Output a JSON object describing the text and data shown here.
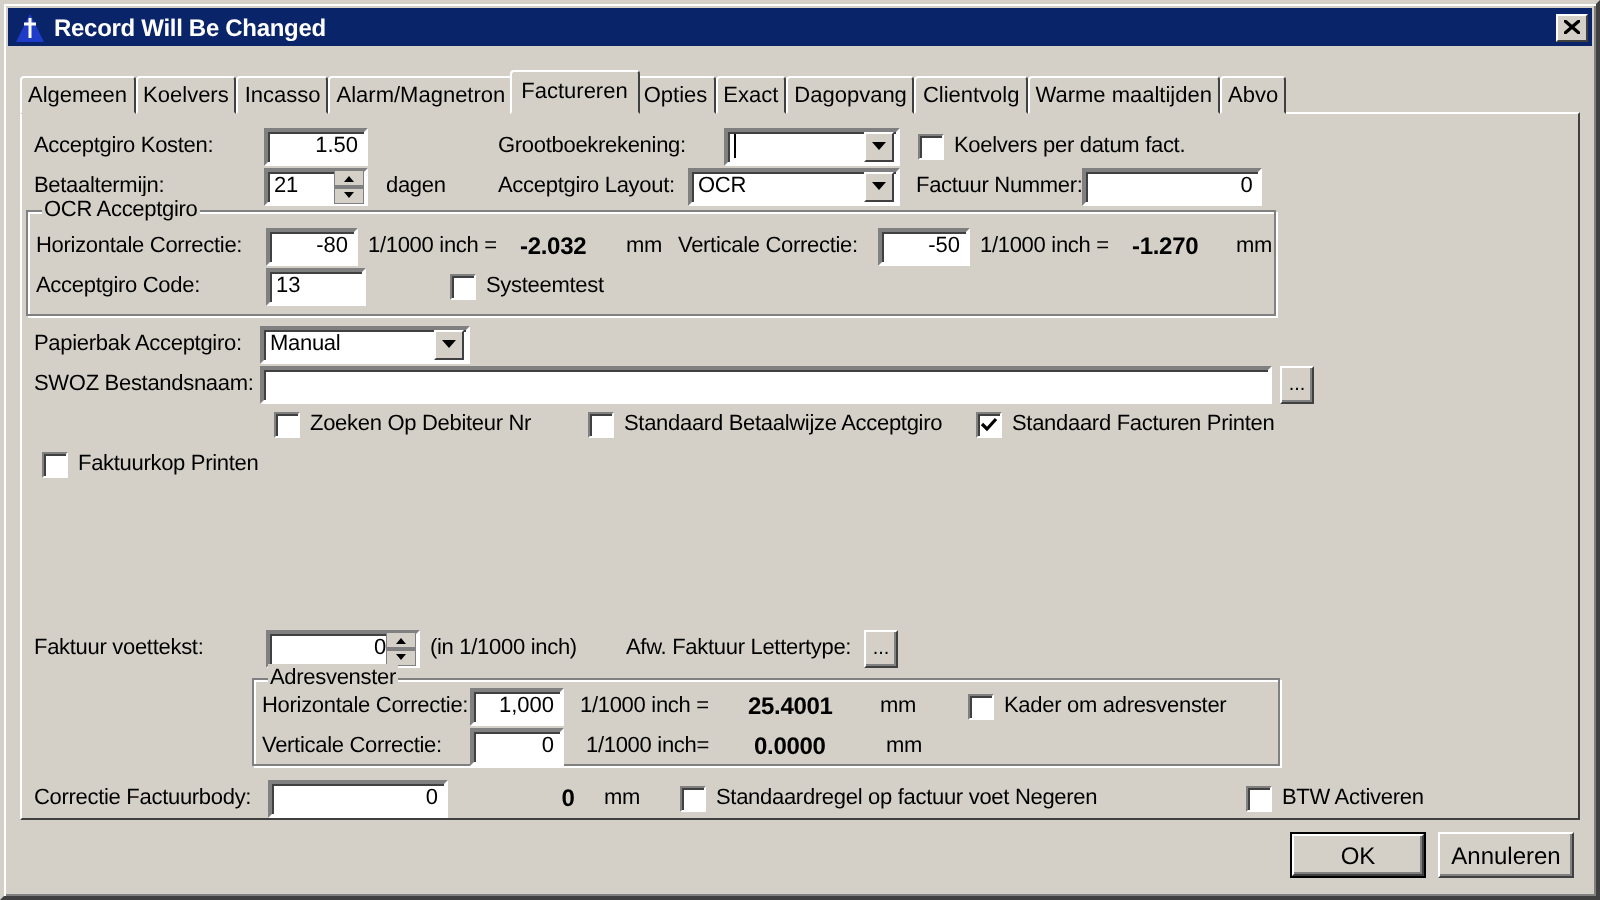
{
  "window": {
    "title": "Record Will Be Changed"
  },
  "tabs": [
    {
      "label": "Algemeen",
      "selected": false
    },
    {
      "label": "Koelvers",
      "selected": false
    },
    {
      "label": "Incasso",
      "selected": false
    },
    {
      "label": "Alarm/Magnetron",
      "selected": false
    },
    {
      "label": "Factureren",
      "selected": true
    },
    {
      "label": "Opties",
      "selected": false
    },
    {
      "label": "Exact",
      "selected": false
    },
    {
      "label": "Dagopvang",
      "selected": false
    },
    {
      "label": "Clientvolg",
      "selected": false
    },
    {
      "label": "Warme maaltijden",
      "selected": false
    },
    {
      "label": "Abvo",
      "selected": false
    }
  ],
  "acceptgiro_kosten": {
    "label": "Acceptgiro Kosten:",
    "value": "1.50"
  },
  "grootboekrekening": {
    "label": "Grootboekrekening:"
  },
  "koelvers_per_datum": {
    "label": "Koelvers per datum fact.",
    "checked": false
  },
  "betaaltermijn": {
    "label": "Betaaltermijn:",
    "value": "21",
    "unit": "dagen"
  },
  "acceptgiro_layout": {
    "label": "Acceptgiro Layout:",
    "value": "OCR"
  },
  "factuur_nummer": {
    "label": "Factuur Nummer:",
    "value": "0"
  },
  "ocr_group": {
    "title": "OCR Acceptgiro",
    "horizontal": {
      "label": "Horizontale Correctie:",
      "value": "-80",
      "unit": "1/1000 inch =",
      "result": "-2.032",
      "result_unit": "mm"
    },
    "vertical": {
      "label": "Verticale Correctie:",
      "value": "-50",
      "unit": "1/1000 inch =",
      "result": "-1.270",
      "result_unit": "mm"
    },
    "code": {
      "label": "Acceptgiro Code:",
      "value": "13"
    },
    "systeemtest": {
      "label": "Systeemtest",
      "checked": false
    }
  },
  "papierbak": {
    "label": "Papierbak Acceptgiro:",
    "value": "Manual"
  },
  "swoz": {
    "label": "SWOZ Bestandsnaam:",
    "browse": "..."
  },
  "options": [
    {
      "label": "Zoeken Op Debiteur Nr",
      "checked": false
    },
    {
      "label": "Standaard Betaalwijze Acceptgiro",
      "checked": false
    },
    {
      "label": "Standaard Facturen Printen",
      "checked": true
    }
  ],
  "faktuurkop": {
    "label": "Faktuurkop Printen",
    "checked": false
  },
  "voettekst": {
    "label": "Faktuur voettekst:",
    "value": "0",
    "unit": "(in 1/1000 inch)"
  },
  "lettertype": {
    "label": "Afw. Faktuur Lettertype:",
    "button": "..."
  },
  "adres_group": {
    "title": "Adresvenster",
    "horizontal": {
      "label": "Horizontale Correctie:",
      "value": "1,000",
      "unit": "1/1000 inch =",
      "result": "25.4001",
      "result_unit": "mm"
    },
    "vertical": {
      "label": "Verticale Correctie:",
      "value": "0",
      "unit": "1/1000 inch=",
      "result": "0.0000",
      "result_unit": "mm"
    },
    "kader": {
      "label": "Kader om adresvenster",
      "checked": false
    }
  },
  "factuurbody": {
    "label": "Correctie Factuurbody:",
    "value": "0",
    "result": "0",
    "result_unit": "mm"
  },
  "standaardregel": {
    "label": "Standaardregel op factuur voet Negeren",
    "checked": false
  },
  "btw": {
    "label": "BTW Activeren",
    "checked": false
  },
  "buttons": [
    {
      "label": "OK",
      "default": true
    },
    {
      "label": "Annuleren",
      "default": false
    }
  ]
}
